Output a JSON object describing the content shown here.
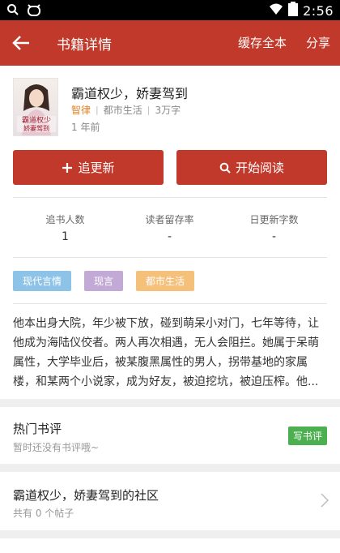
{
  "status_bar": {
    "time": "2:56",
    "battery": "2"
  },
  "app_bar": {
    "title": "书籍详情",
    "cache_all": "缓存全本",
    "share": "分享"
  },
  "book": {
    "title": "霸道权少，娇妻驾到",
    "author": "智律",
    "category": "都市生活",
    "word_count": "3万字",
    "updated": "1 年前",
    "cover_text": "霸道权少,娇妻驾到"
  },
  "actions": {
    "follow": "追更新",
    "read": "开始阅读"
  },
  "stats": [
    {
      "label": "追书人数",
      "value": "1"
    },
    {
      "label": "读者留存率",
      "value": "-"
    },
    {
      "label": "日更新字数",
      "value": "-"
    }
  ],
  "tags": [
    {
      "label": "现代言情",
      "color": "#8ec3e8"
    },
    {
      "label": "现言",
      "color": "#c3a9d6"
    },
    {
      "label": "都市生活",
      "color": "#f5c07a"
    }
  ],
  "synopsis": "他本出身大院，年少被下放，碰到萌呆小对门，七年等待，让他成为海陆仪佼者。两人再次相遇，无人会阻拦。她属于呆萌属性，大学毕业后，被某腹黑属性的男人，拐带基地的家属楼，和某两个小说家，成为好友，被迫挖坑，被迫压榨。他...",
  "reviews": {
    "title": "热门书评",
    "empty": "暂时还没有书评哦~",
    "write": "写书评"
  },
  "community": {
    "title": "霸道权少，娇妻驾到的社区",
    "posts": "共有 0 个帖子"
  },
  "colors": {
    "primary": "#c0392b",
    "accent": "#e67e22",
    "green": "#4caf50"
  }
}
